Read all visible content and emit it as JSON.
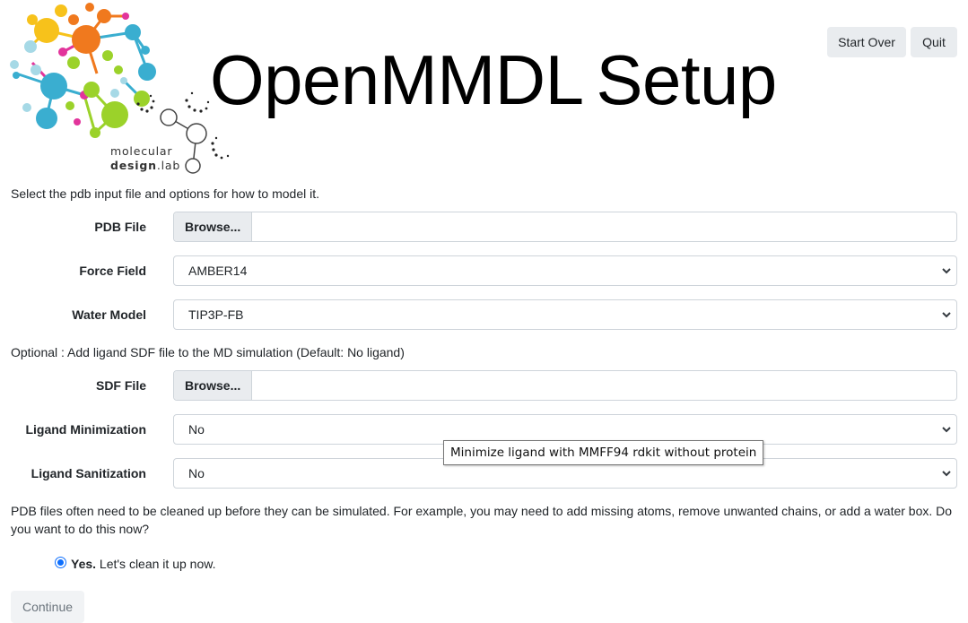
{
  "header": {
    "title_part1": "OpenMMDL",
    "title_part2": "Setup",
    "logo_line1": "molecular",
    "logo_line2_bold": "design",
    "logo_line2_rest": ".lab",
    "start_over_label": "Start Over",
    "quit_label": "Quit"
  },
  "intro_text": "Select the pdb input file and options for how to model it.",
  "pdb_file": {
    "label": "PDB File",
    "browse_label": "Browse...",
    "value": ""
  },
  "force_field": {
    "label": "Force Field",
    "value": "AMBER14"
  },
  "water_model": {
    "label": "Water Model",
    "value": "TIP3P-FB"
  },
  "optional_text": "Optional : Add ligand SDF file to the MD simulation (Default: No ligand)",
  "sdf_file": {
    "label": "SDF File",
    "browse_label": "Browse...",
    "value": ""
  },
  "ligand_minimization": {
    "label": "Ligand Minimization",
    "value": "No"
  },
  "ligand_sanitization": {
    "label": "Ligand Sanitization",
    "value": "No"
  },
  "tooltip": "Minimize ligand with MMFF94 rdkit without protein",
  "cleanup_text": "PDB files often need to be cleaned up before they can be simulated. For example, you may need to add missing atoms, remove unwanted chains, or add a water box. Do you want to do this now?",
  "cleanup_option": {
    "bold": "Yes.",
    "rest": " Let's clean it up now.",
    "checked": true
  },
  "continue_label": "Continue",
  "colors": {
    "accent": "#0d6efd",
    "logo_yellow": "#f7c21b",
    "logo_orange": "#f0791e",
    "logo_blue": "#3aaed0",
    "logo_green": "#9bd22a",
    "logo_magenta": "#e2349b",
    "logo_light_blue": "#a6d9e6"
  }
}
